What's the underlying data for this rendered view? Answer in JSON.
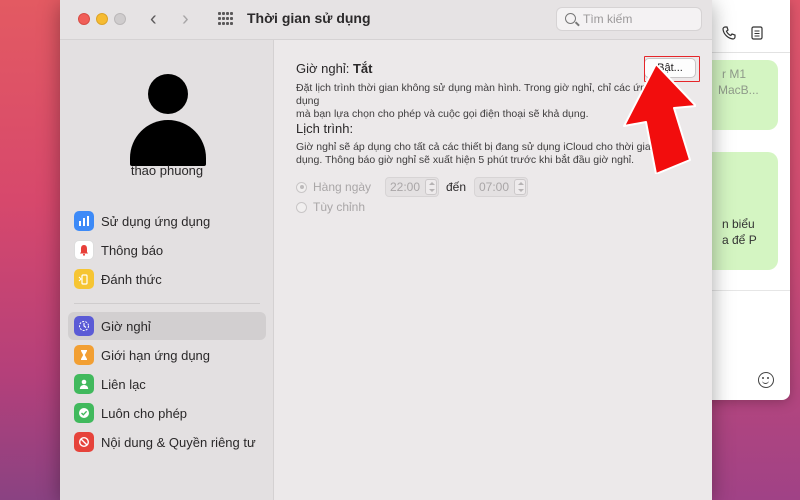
{
  "window": {
    "title": "Thời gian sử dụng",
    "search_placeholder": "Tìm kiếm"
  },
  "sidebar": {
    "username": "thao phuong",
    "items": [
      {
        "label": "Sử dụng ứng dụng",
        "icon": "bar-chart-icon",
        "color": "#3d8af7"
      },
      {
        "label": "Thông báo",
        "icon": "bell-icon",
        "color": "#ffffff"
      },
      {
        "label": "Đánh thức",
        "icon": "phone-pickup-icon",
        "color": "#f6c533"
      },
      {
        "label": "Giờ nghỉ",
        "icon": "downtime-icon",
        "color": "#5b5bd6",
        "active": true
      },
      {
        "label": "Giới hạn ứng dụng",
        "icon": "hourglass-icon",
        "color": "#f29f33"
      },
      {
        "label": "Liên lạc",
        "icon": "person-icon",
        "color": "#41b95d"
      },
      {
        "label": "Luôn cho phép",
        "icon": "checkmark-icon",
        "color": "#41b95d"
      },
      {
        "label": "Nội dung & Quyền riêng tư",
        "icon": "restriction-icon",
        "color": "#e6433b"
      }
    ]
  },
  "content": {
    "downtime_label": "Giờ nghỉ:",
    "downtime_status": "Tắt",
    "turn_on_button": "Bật...",
    "description_line1": "Đặt lịch trình thời gian không sử dụng màn hình. Trong giờ nghỉ, chỉ các ứng dụng",
    "description_line2": "mà bạn lựa chọn cho phép và cuộc gọi điện thoại sẽ khả dụng.",
    "schedule_label": "Lịch trình:",
    "schedule_line1": "Giờ nghỉ sẽ áp dụng cho tất cả các thiết bị đang sử dụng iCloud cho thời gian sử",
    "schedule_line2": "dụng. Thông báo giờ nghỉ sẽ xuất hiện 5 phút trước khi bắt đầu giờ nghỉ.",
    "option_daily": "Hàng ngày",
    "option_custom": "Tùy chỉnh",
    "start_time": "22:00",
    "to_label": "đến",
    "end_time": "07:00"
  },
  "messages_window": {
    "bubble1_line1": "r M1",
    "bubble1_line2": "MacB...",
    "bubble2_line1": "n biểu",
    "bubble2_line2": "a để P"
  },
  "annotation": {
    "highlight_color": "#e5262a",
    "arrow_color": "#f20d0d"
  }
}
